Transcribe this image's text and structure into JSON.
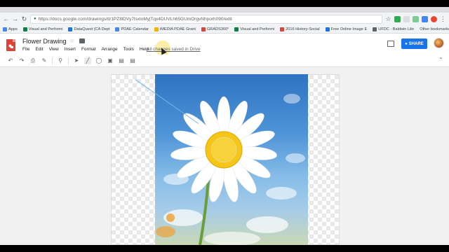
{
  "browser": {
    "url": "https://docs.google.com/drawings/d/1PZ8lDVy7lsxtoMyjTqx4DUVLh65GUmOrgvNhporh090/edit",
    "bookmarks": [
      {
        "label": "Apps",
        "color": "#4285f4"
      },
      {
        "label": "Visual and Performi",
        "color": "#0b8043"
      },
      {
        "label": "DataQuest (CA Dept",
        "color": "#1a73e8"
      },
      {
        "label": "PDAE Calendar",
        "color": "#4285f4"
      },
      {
        "label": "iMEDIA PDAE Grant",
        "color": "#f4b400"
      },
      {
        "label": "GRADS360°",
        "color": "#db4437"
      },
      {
        "label": "Visual and Performi",
        "color": "#0b8043"
      },
      {
        "label": "2016 History-Social",
        "color": "#db4437"
      },
      {
        "label": "Free Online Image E",
        "color": "#1a73e8"
      },
      {
        "label": "UFDC - Baldwin Libr",
        "color": "#5f6368"
      }
    ],
    "other_bookmarks": "Other bookmarks"
  },
  "header": {
    "title": "Flower Drawing",
    "menus": [
      "File",
      "Edit",
      "View",
      "Insert",
      "Format",
      "Arrange",
      "Tools",
      "Help"
    ],
    "save_status": "All changes saved in Drive",
    "share_label": "SHARE"
  },
  "toolbar": {
    "icons": [
      "undo-icon",
      "redo-icon",
      "print-icon",
      "paint-format-icon",
      "zoom-icon",
      "select-icon",
      "line-icon",
      "shape-icon",
      "text-box-icon",
      "image-icon",
      "comment-add-icon"
    ]
  },
  "colors": {
    "accent": "#1a73e8",
    "logo": "#db4437",
    "daisy_center": "#f5c518",
    "sky": "#4f94d8"
  }
}
